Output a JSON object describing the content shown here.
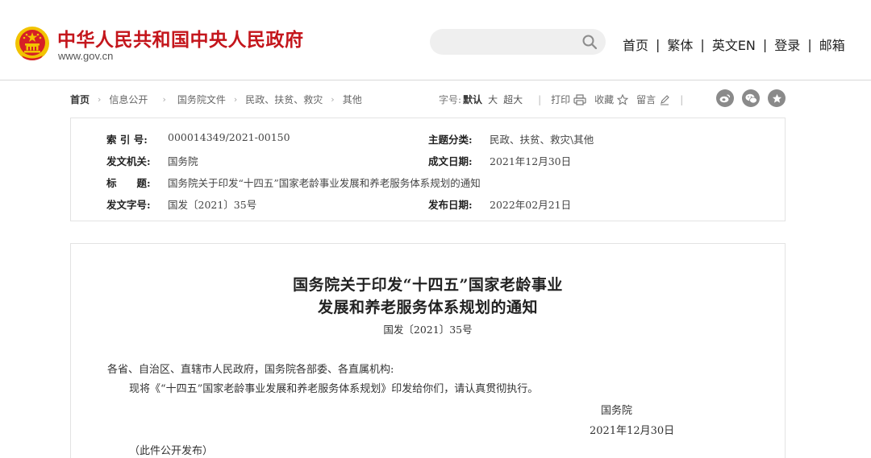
{
  "header": {
    "site_title": "中华人民共和国中央人民政府",
    "site_url": "www.gov.cn",
    "search": {
      "placeholder": ""
    },
    "nav": [
      "首页",
      "繁体",
      "英文EN",
      "登录",
      "邮箱"
    ],
    "nav_separator": "|"
  },
  "breadcrumb": {
    "items": [
      "首页",
      "信息公开",
      "国务院文件",
      "民政、扶贫、救灾",
      "其他"
    ]
  },
  "tools": {
    "font_size_label": "字号:",
    "font_sizes": [
      "默认",
      "大",
      "超大"
    ],
    "separator": "|",
    "print_label": "打印",
    "favorite_label": "收藏",
    "comment_label": "留言"
  },
  "social": [
    "weibo-icon",
    "wechat-icon",
    "star-icon"
  ],
  "info": {
    "index_no_label": "索 引 号:",
    "index_no": "000014349/2021-00150",
    "topic_label": "主题分类:",
    "topic": "民政、扶贫、救灾\\其他",
    "issuer_label": "发文机关:",
    "issuer": "国务院",
    "created_label": "成文日期:",
    "created": "2021年12月30日",
    "title_label": "标　　题:",
    "title": "国务院关于印发“十四五”国家老龄事业发展和养老服务体系规划的通知",
    "doc_no_label": "发文字号:",
    "doc_no": "国发〔2021〕35号",
    "published_label": "发布日期:",
    "published": "2022年02月21日"
  },
  "document": {
    "title_line1": "国务院关于印发“十四五”国家老龄事业",
    "title_line2": "发展和养老服务体系规划的通知",
    "number": "国发〔2021〕35号",
    "addressee": "各省、自治区、直辖市人民政府，国务院各部委、各直属机构:",
    "body": "现将《“十四五”国家老龄事业发展和养老服务体系规划》印发给你们，请认真贯彻执行。",
    "signer": "国务院",
    "date": "2021年12月30日",
    "note": "（此件公开发布）"
  },
  "colors": {
    "brand_red": "#c4161c",
    "emblem_gold": "#f2c300"
  }
}
